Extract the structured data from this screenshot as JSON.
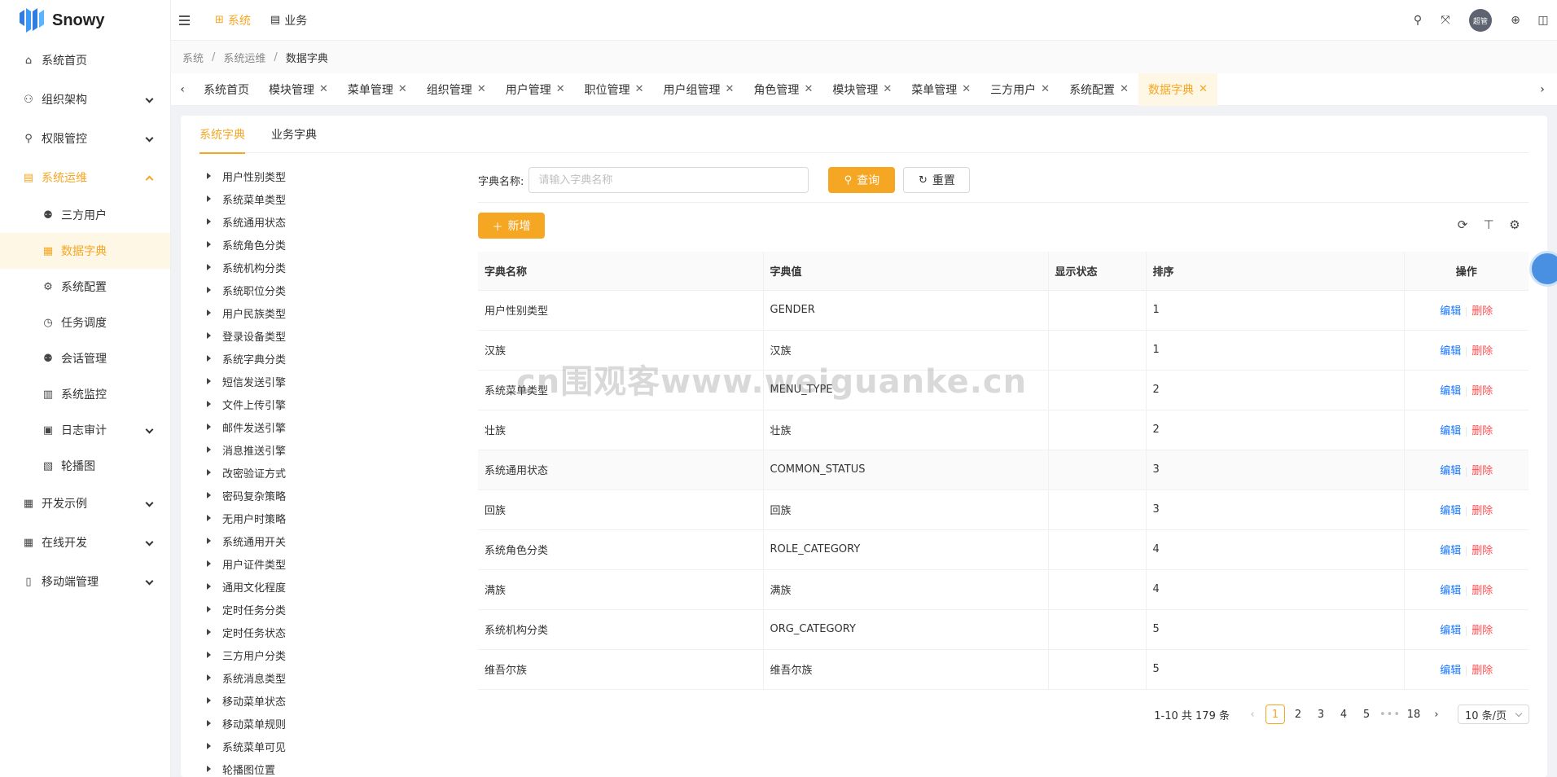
{
  "app": {
    "name": "Snowy"
  },
  "sidebar": {
    "items": [
      {
        "label": "系统首页",
        "icon": "home-icon"
      },
      {
        "label": "组织架构",
        "icon": "org-icon"
      },
      {
        "label": "权限管控",
        "icon": "user-icon"
      },
      {
        "label": "系统运维",
        "icon": "book-icon"
      },
      {
        "label": "开发示例",
        "icon": "calendar-icon"
      },
      {
        "label": "在线开发",
        "icon": "calendar-icon"
      },
      {
        "label": "移动端管理",
        "icon": "mobile-icon"
      }
    ],
    "submenu": [
      {
        "label": "三方用户"
      },
      {
        "label": "数据字典"
      },
      {
        "label": "系统配置"
      },
      {
        "label": "任务调度"
      },
      {
        "label": "会话管理"
      },
      {
        "label": "系统监控"
      },
      {
        "label": "日志审计"
      },
      {
        "label": "轮播图"
      }
    ]
  },
  "header": {
    "top_tabs": [
      {
        "label": "系统"
      },
      {
        "label": "业务"
      }
    ],
    "avatar_text": "超管"
  },
  "breadcrumb": {
    "items": [
      "系统",
      "系统运维",
      "数据字典"
    ]
  },
  "tabs": [
    {
      "label": "系统首页"
    },
    {
      "label": "模块管理"
    },
    {
      "label": "菜单管理"
    },
    {
      "label": "组织管理"
    },
    {
      "label": "用户管理"
    },
    {
      "label": "职位管理"
    },
    {
      "label": "用户组管理"
    },
    {
      "label": "角色管理"
    },
    {
      "label": "模块管理"
    },
    {
      "label": "菜单管理"
    },
    {
      "label": "三方用户"
    },
    {
      "label": "系统配置"
    },
    {
      "label": "数据字典"
    }
  ],
  "dict_tabs": [
    {
      "label": "系统字典"
    },
    {
      "label": "业务字典"
    }
  ],
  "tree": [
    "用户性别类型",
    "系统菜单类型",
    "系统通用状态",
    "系统角色分类",
    "系统机构分类",
    "系统职位分类",
    "用户民族类型",
    "登录设备类型",
    "系统字典分类",
    "短信发送引擎",
    "文件上传引擎",
    "邮件发送引擎",
    "消息推送引擎",
    "改密验证方式",
    "密码复杂策略",
    "无用户时策略",
    "系统通用开关",
    "用户证件类型",
    "通用文化程度",
    "定时任务分类",
    "定时任务状态",
    "三方用户分类",
    "系统消息类型",
    "移动菜单状态",
    "移动菜单规则",
    "系统菜单可见",
    "轮播图位置"
  ],
  "search": {
    "label": "字典名称:",
    "placeholder": "请输入字典名称",
    "query_label": "查询",
    "reset_label": "重置"
  },
  "toolbar": {
    "add_label": "新增"
  },
  "table": {
    "columns": [
      "字典名称",
      "字典值",
      "显示状态",
      "排序",
      "操作"
    ],
    "rows": [
      [
        "用户性别类型",
        "GENDER",
        "",
        "1"
      ],
      [
        "汉族",
        "汉族",
        "",
        "1"
      ],
      [
        "系统菜单类型",
        "MENU_TYPE",
        "",
        "2"
      ],
      [
        "壮族",
        "壮族",
        "",
        "2"
      ],
      [
        "系统通用状态",
        "COMMON_STATUS",
        "",
        "3"
      ],
      [
        "回族",
        "回族",
        "",
        "3"
      ],
      [
        "系统角色分类",
        "ROLE_CATEGORY",
        "",
        "4"
      ],
      [
        "满族",
        "满族",
        "",
        "4"
      ],
      [
        "系统机构分类",
        "ORG_CATEGORY",
        "",
        "5"
      ],
      [
        "维吾尔族",
        "维吾尔族",
        "",
        "5"
      ]
    ],
    "edit_label": "编辑",
    "delete_label": "删除"
  },
  "pagination": {
    "total_text": "1-10 共 179 条",
    "pages": [
      "1",
      "2",
      "3",
      "4",
      "5"
    ],
    "ellipsis": "•••",
    "last_page": "18",
    "page_size": "10 条/页"
  },
  "watermark": "cn围观客www.weiguanke.cn",
  "colors": {
    "accent": "#f5a623",
    "link": "#1677ff",
    "danger": "#ff4d4f"
  }
}
